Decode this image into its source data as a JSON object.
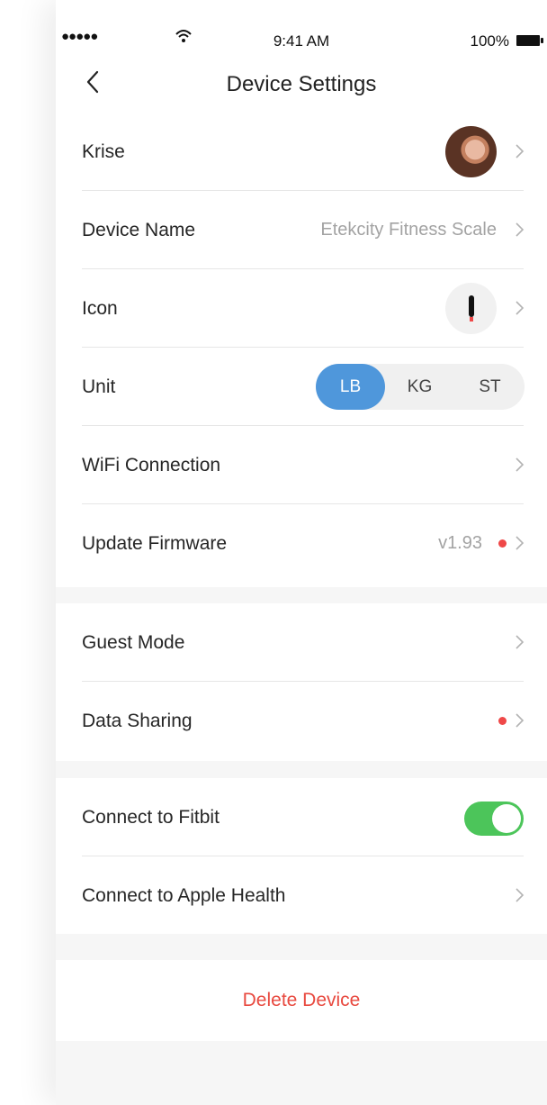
{
  "status_bar": {
    "signal": "●●●●●",
    "time": "9:41 AM",
    "battery": "100%"
  },
  "nav": {
    "title": "Device Settings",
    "back_icon": "chevron-left-icon"
  },
  "settings": {
    "profile": {
      "label": "Krise"
    },
    "device_name": {
      "label": "Device Name",
      "value": "Etekcity Fitness Scale"
    },
    "icon": {
      "label": "Icon"
    },
    "unit": {
      "label": "Unit",
      "options": [
        "LB",
        "KG",
        "ST"
      ],
      "selected": "LB"
    },
    "wifi": {
      "label": "WiFi Connection"
    },
    "firmware": {
      "label": "Update Firmware",
      "value": "v1.93"
    },
    "guest_mode": {
      "label": "Guest Mode"
    },
    "data_sharing": {
      "label": "Data Sharing"
    },
    "fitbit": {
      "label": "Connect to Fitbit",
      "enabled": true
    },
    "apple_health": {
      "label": "Connect to Apple Health"
    }
  },
  "actions": {
    "delete": "Delete Device"
  },
  "colors": {
    "accent_blue": "#4f97db",
    "toggle_green": "#4cc55a",
    "alert_red": "#ef4848",
    "delete_red": "#e8493f"
  }
}
